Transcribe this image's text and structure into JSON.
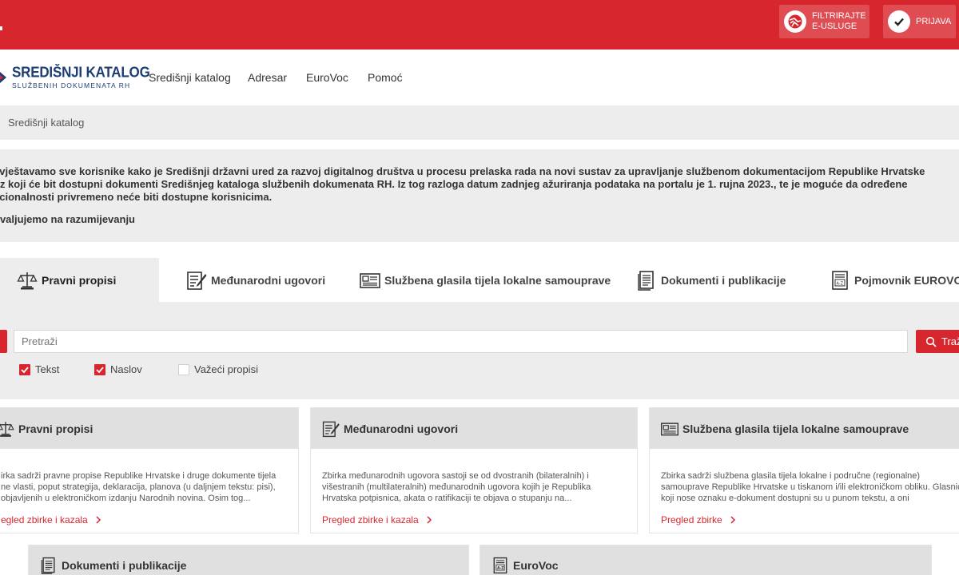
{
  "topbar": {
    "filter_label_1": "FILTRIRAJTE",
    "filter_label_2": "E-USLUGE",
    "login_label": "PRIJAVA",
    "brand_color": "#d8262e"
  },
  "logo": {
    "title": "SREDIŠNJI KATALOG",
    "subtitle": "SLUŽBENIH DOKUMENATA RH"
  },
  "nav": {
    "items": [
      "Središnji katalog",
      "Adresar",
      "EuroVoc",
      "Pomoć"
    ]
  },
  "breadcrumb": {
    "current": "Središnji katalog"
  },
  "notice": {
    "line1": "avještavamo sve korisnike kako je Središnji državni ured za razvoj digitalnog društva u procesu prelaska rada na novi sustav za upravljanje službenom dokumentacijom Republike Hrvatske",
    "line2": "oz koji će bit dostupni dokumenti Središnjeg kataloga službenih dokumenata RH. Iz tog razloga datum zadnjeg ažuriranja podataka na portalu je 1. rujna 2023., te je moguće da određene",
    "line3": "kcionalnosti privremeno neće biti dostupne korisnicima.",
    "line4": "hvaljujemo na razumijevanju"
  },
  "tabs": [
    {
      "label": "Pravni propisi",
      "icon": "scales-icon",
      "active": true
    },
    {
      "label": "Međunarodni ugovori",
      "icon": "document-pen-icon",
      "active": false
    },
    {
      "label": "Službena glasila tijela lokalne samouprave",
      "icon": "newspaper-icon",
      "active": false
    },
    {
      "label": "Dokumenti i publikacije",
      "icon": "documents-stack-icon",
      "active": false
    },
    {
      "label": "Pojmovnik EUROVOC",
      "icon": "glossary-az-icon",
      "active": false
    }
  ],
  "search": {
    "placeholder": "Pretraži",
    "button_label": "Traž",
    "checkboxes": [
      {
        "label": "Tekst",
        "checked": true
      },
      {
        "label": "Naslov",
        "checked": true
      },
      {
        "label": "Važeći propisi",
        "checked": false
      }
    ]
  },
  "cards": [
    {
      "title": "Pravni propisi",
      "icon": "scales-icon",
      "desc": "irka sadrži pravne propise Republike Hrvatske i druge dokumente tijela ne vlasti, poput strategija, deklaracija, planova (u daljnjem tekstu: pisi), objavljenih u elektroničkom izdanju Narodnih novina. Osim tog...",
      "link": "egled zbirke i kazala"
    },
    {
      "title": "Međunarodni ugovori",
      "icon": "document-pen-icon",
      "desc": "Zbirka međunarodnih ugovora sastoji se od dvostranih (bilateralnih) i višestranih (multilateralnih) međunarodnih ugovora kojih je Republika Hrvatska potpisnica, akata o ratifikaciji te objava o stupanju na...",
      "link": "Pregled zbirke i kazala"
    },
    {
      "title": "Službena glasila tijela lokalne samouprave",
      "icon": "newspaper-icon",
      "desc": "Zbirka sadrži službena glasila tijela lokalne i područne (regionalne) samouprave Republike Hrvatske u tiskanom i/ili elektroničkom obliku. Glasnici koji nose oznaku e-dokument dostupni su u punom tekstu, a oni",
      "link": "Pregled zbirke"
    },
    {
      "title": "Dokumenti i publikacije",
      "icon": "documents-stack-icon"
    },
    {
      "title": "EuroVoc",
      "icon": "glossary-az-icon"
    }
  ]
}
